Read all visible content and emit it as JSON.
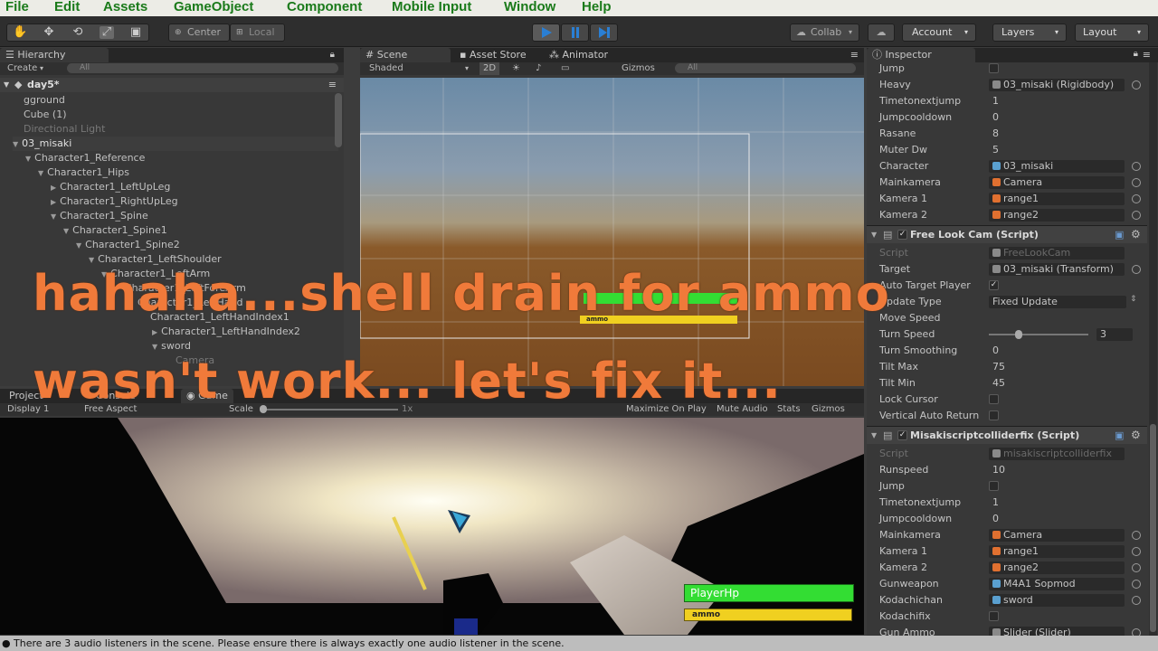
{
  "menu": [
    "File",
    "Edit",
    "Assets",
    "GameObject",
    "Component",
    "Mobile Input",
    "Window",
    "Help"
  ],
  "toolbar": {
    "pivot": "Center",
    "space": "Local",
    "collab": "Collab",
    "account": "Account",
    "layers": "Layers",
    "layout": "Layout"
  },
  "hierarchy": {
    "tab": "Hierarchy",
    "create": "Create",
    "search_placeholder": "All",
    "scene": "day5*",
    "items": [
      {
        "label": "gground",
        "style": "normal"
      },
      {
        "label": "Cube (1)",
        "style": "normal"
      },
      {
        "label": "Directional Light",
        "style": "dim"
      },
      {
        "label": "03_misaki",
        "style": "sel"
      },
      {
        "label": "Character1_Reference",
        "style": "normal"
      },
      {
        "label": "Character1_Hips",
        "style": "normal"
      },
      {
        "label": "Character1_LeftUpLeg",
        "style": "normal"
      },
      {
        "label": "Character1_RightUpLeg",
        "style": "normal"
      },
      {
        "label": "Character1_Spine",
        "style": "normal"
      },
      {
        "label": "Character1_Spine1",
        "style": "normal"
      },
      {
        "label": "Character1_Spine2",
        "style": "normal"
      },
      {
        "label": "Character1_LeftShoulder",
        "style": "normal"
      },
      {
        "label": "Character1_LeftArm",
        "style": "normal"
      },
      {
        "label": "Character1_LeftForeArm",
        "style": "normal"
      },
      {
        "label": "Character1_LeftHand",
        "style": "normal"
      },
      {
        "label": "Character1_LeftHandIndex1",
        "style": "normal"
      },
      {
        "label": "Character1_LeftHandIndex2",
        "style": "normal"
      },
      {
        "label": "sword",
        "style": "normal"
      },
      {
        "label": "Camera",
        "style": "dim"
      }
    ]
  },
  "scene": {
    "tabs": [
      "Scene",
      "Asset Store",
      "Animator"
    ],
    "shading": "Shaded",
    "mode_2d": "2D",
    "gizmos": "Gizmos",
    "search_placeholder": "All",
    "ui_label_ammo": "ammo"
  },
  "bottom": {
    "tabs": [
      "Project",
      "Console",
      "Game"
    ],
    "display": "Display 1",
    "aspect": "Free Aspect",
    "scale_label": "Scale",
    "scale_value": "1x",
    "options": [
      "Maximize On Play",
      "Mute Audio",
      "Stats",
      "Gizmos"
    ],
    "player_hp_label": "PlayerHp",
    "ammo_label": "ammo"
  },
  "inspector": {
    "tab": "Inspector",
    "rows_top": [
      {
        "label": "Jump",
        "type": "checkbox",
        "checked": false
      },
      {
        "label": "Heavy",
        "type": "ref",
        "value": "03_misaki (Rigidbody)"
      },
      {
        "label": "Timetonextjump",
        "type": "text",
        "value": "1"
      },
      {
        "label": "Jumpcooldown",
        "type": "text",
        "value": "0"
      },
      {
        "label": "Rasane",
        "type": "text",
        "value": "8"
      },
      {
        "label": "Muter Dw",
        "type": "text",
        "value": "5"
      },
      {
        "label": "Character",
        "type": "ref",
        "value": "03_misaki"
      },
      {
        "label": "Mainkamera",
        "type": "ref",
        "value": "Camera"
      },
      {
        "label": "Kamera 1",
        "type": "ref",
        "value": "range1"
      },
      {
        "label": "Kamera 2",
        "type": "ref",
        "value": "range2"
      }
    ],
    "comp1_title": "Free Look Cam (Script)",
    "rows_comp1": [
      {
        "label": "Script",
        "type": "ref-dim",
        "value": "FreeLookCam"
      },
      {
        "label": "Target",
        "type": "ref",
        "value": "03_misaki (Transform)"
      },
      {
        "label": "Auto Target Player",
        "type": "checkbox",
        "checked": true
      },
      {
        "label": "Update Type",
        "type": "dropdown",
        "value": "Fixed Update"
      },
      {
        "label": "Move Speed",
        "type": "text",
        "value": ""
      },
      {
        "label": "Turn Speed",
        "type": "slider",
        "value": "3"
      },
      {
        "label": "Turn Smoothing",
        "type": "text",
        "value": "0"
      },
      {
        "label": "Tilt Max",
        "type": "text",
        "value": "75"
      },
      {
        "label": "Tilt Min",
        "type": "text",
        "value": "45"
      },
      {
        "label": "Lock Cursor",
        "type": "checkbox",
        "checked": false
      },
      {
        "label": "Vertical Auto Return",
        "type": "checkbox",
        "checked": false
      }
    ],
    "comp2_title": "Misakiscriptcolliderfix (Script)",
    "rows_comp2": [
      {
        "label": "Script",
        "type": "ref-dim",
        "value": "misakiscriptcolliderfix"
      },
      {
        "label": "Runspeed",
        "type": "text",
        "value": "10"
      },
      {
        "label": "Jump",
        "type": "checkbox",
        "checked": false
      },
      {
        "label": "Timetonextjump",
        "type": "text",
        "value": "1"
      },
      {
        "label": "Jumpcooldown",
        "type": "text",
        "value": "0"
      },
      {
        "label": "Mainkamera",
        "type": "ref",
        "value": "Camera"
      },
      {
        "label": "Kamera 1",
        "type": "ref",
        "value": "range1"
      },
      {
        "label": "Kamera 2",
        "type": "ref",
        "value": "range2"
      },
      {
        "label": "Gunweapon",
        "type": "ref",
        "value": "M4A1 Sopmod"
      },
      {
        "label": "Kodachichan",
        "type": "ref",
        "value": "sword"
      },
      {
        "label": "Kodachifix",
        "type": "checkbox",
        "checked": false
      },
      {
        "label": "Gun Ammo",
        "type": "ref",
        "value": "Slider (Slider)"
      }
    ]
  },
  "caption": {
    "line1": "hahaha...shell drain for ammo",
    "line2": "wasn't work... let's fix it..."
  },
  "status": "There are 3 audio listeners in the scene. Please ensure there is always exactly one audio listener in the scene.",
  "colors": {
    "caption": "#f07a3a",
    "menu_text": "#1a7a1a",
    "hp_bar": "#33dd33",
    "ammo_bar": "#f0d020",
    "play_blue": "#2a7fd4"
  }
}
